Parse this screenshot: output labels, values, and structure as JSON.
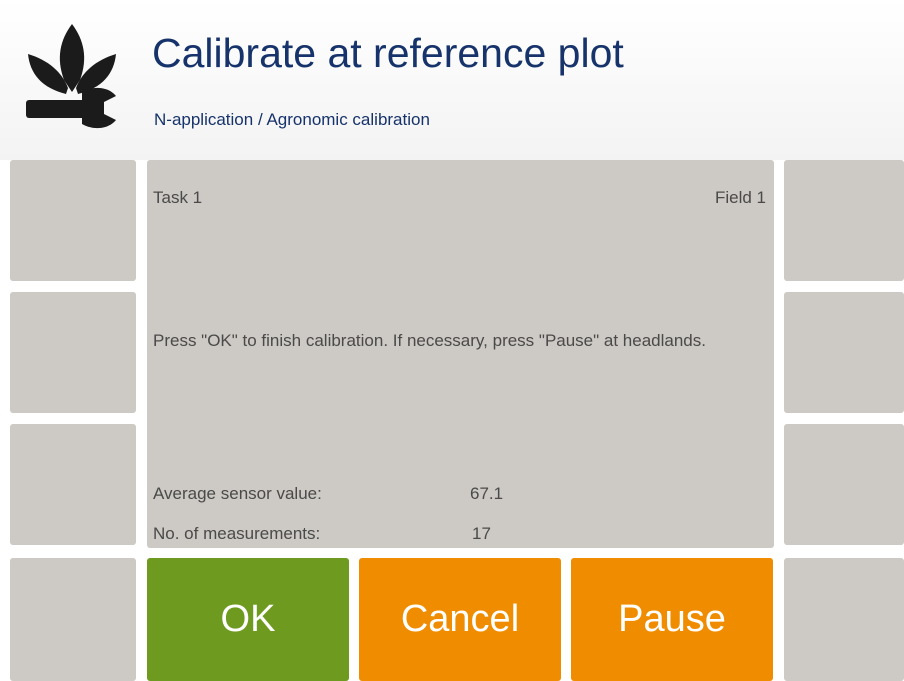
{
  "header": {
    "title": "Calibrate at reference plot",
    "subtitle": "N-application / Agronomic calibration",
    "logo_icon": "plant-wrench-icon"
  },
  "panel": {
    "task_label": "Task 1",
    "field_label": "Field 1",
    "message": "Press \"OK\" to finish calibration. If necessary, press \"Pause\" at headlands.",
    "stats": {
      "average_label": "Average sensor value:",
      "average_value": "67.1",
      "count_label": "No. of measurements:",
      "count_value": "17"
    }
  },
  "actions": {
    "ok_label": "OK",
    "cancel_label": "Cancel",
    "pause_label": "Pause"
  },
  "colors": {
    "title": "#17336b",
    "panel_bg": "#cdc9c4",
    "ok_green": "#6e9a1f",
    "cancel_orange": "#f08c00",
    "pause_orange": "#f08c00"
  }
}
